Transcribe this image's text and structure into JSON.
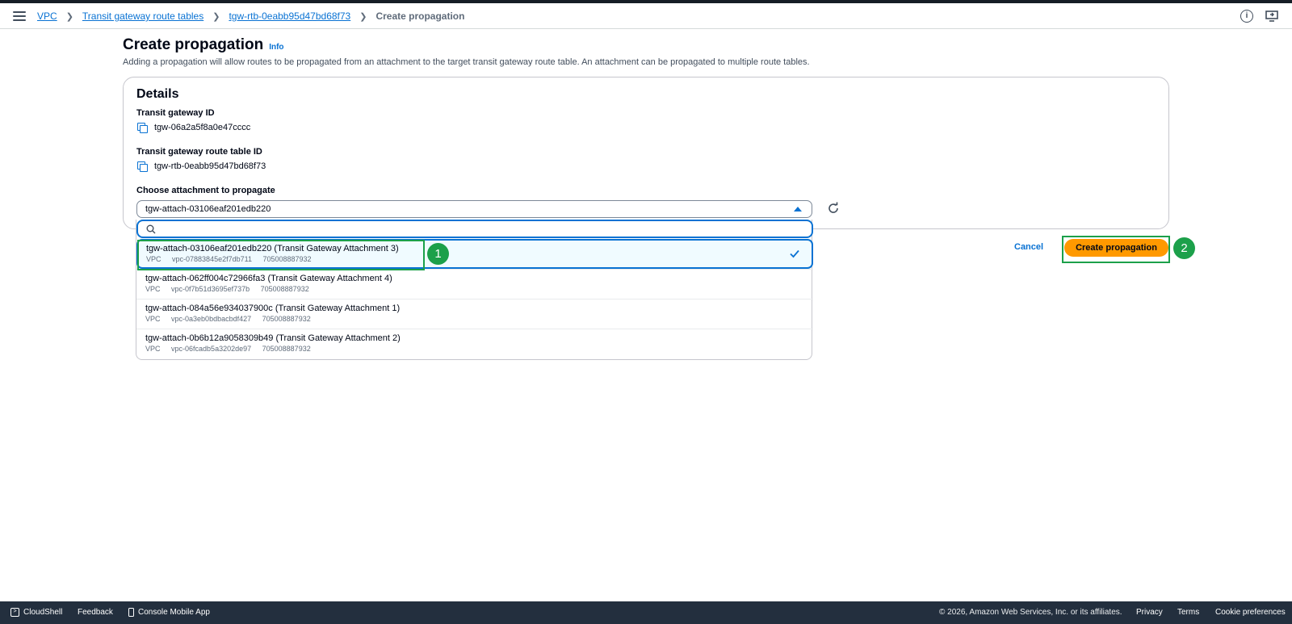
{
  "breadcrumbs": {
    "items": [
      "VPC",
      "Transit gateway route tables",
      "tgw-rtb-0eabb95d47bd68f73"
    ],
    "current": "Create propagation"
  },
  "page": {
    "title": "Create propagation",
    "info_link": "Info",
    "description": "Adding a propagation will allow routes to be propagated from an attachment to the target transit gateway route table. An attachment can be propagated to multiple route tables."
  },
  "details": {
    "title": "Details",
    "tgw_id_label": "Transit gateway ID",
    "tgw_id_value": "tgw-06a2a5f8a0e47cccc",
    "rtb_id_label": "Transit gateway route table ID",
    "rtb_id_value": "tgw-rtb-0eabb95d47bd68f73",
    "attach_label": "Choose attachment to propagate",
    "selected_value": "tgw-attach-03106eaf201edb220",
    "search_placeholder": ""
  },
  "options": [
    {
      "title": "tgw-attach-03106eaf201edb220 (Transit Gateway Attachment 3)",
      "type": "VPC",
      "vpc": "vpc-07883845e2f7db711",
      "account": "705008887932",
      "selected": true
    },
    {
      "title": "tgw-attach-062ff004c72966fa3 (Transit Gateway Attachment 4)",
      "type": "VPC",
      "vpc": "vpc-0f7b51d3695ef737b",
      "account": "705008887932",
      "selected": false
    },
    {
      "title": "tgw-attach-084a56e934037900c (Transit Gateway Attachment 1)",
      "type": "VPC",
      "vpc": "vpc-0a3eb0bdbacbdf427",
      "account": "705008887932",
      "selected": false
    },
    {
      "title": "tgw-attach-0b6b12a9058309b49 (Transit Gateway Attachment 2)",
      "type": "VPC",
      "vpc": "vpc-06fcadb5a3202de97",
      "account": "705008887932",
      "selected": false
    }
  ],
  "actions": {
    "cancel": "Cancel",
    "create": "Create propagation"
  },
  "annotations": {
    "step1": "1",
    "step2": "2"
  },
  "footer": {
    "cloudshell": "CloudShell",
    "feedback": "Feedback",
    "mobile_app": "Console Mobile App",
    "copyright": "© 2026, Amazon Web Services, Inc. or its affiliates.",
    "privacy": "Privacy",
    "terms": "Terms",
    "cookies": "Cookie preferences"
  },
  "icons": [
    "menu-icon",
    "info-icon",
    "screen-share-icon",
    "copy-icon",
    "refresh-icon",
    "search-icon",
    "check-icon",
    "caret-up-icon",
    "cloudshell-icon",
    "mobile-icon"
  ],
  "colors": {
    "link": "#0972d3",
    "primary_button": "#ff9900",
    "annotation": "#1ca04a",
    "footer_bg": "#232f3e"
  }
}
